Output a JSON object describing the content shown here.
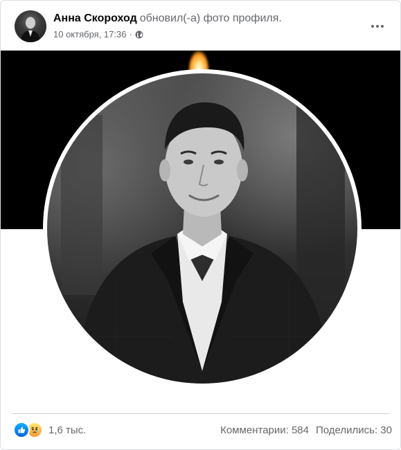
{
  "post": {
    "author_name": "Анна Скороход",
    "action_text": "обновил(-а) фото профиля.",
    "timestamp": "10 октября, 17:36",
    "separator": "·",
    "privacy_icon": "globe-icon",
    "more_icon": "more-options-icon"
  },
  "reactions": {
    "icons": [
      "like-icon",
      "sad-icon"
    ],
    "count": "1,6 тыс."
  },
  "stats": {
    "comments": "Комментарии: 584",
    "shares": "Поделились: 30"
  },
  "colors": {
    "brand_blue": "#1877f2",
    "secondary_text": "#65676b",
    "divider": "#ced0d4"
  }
}
